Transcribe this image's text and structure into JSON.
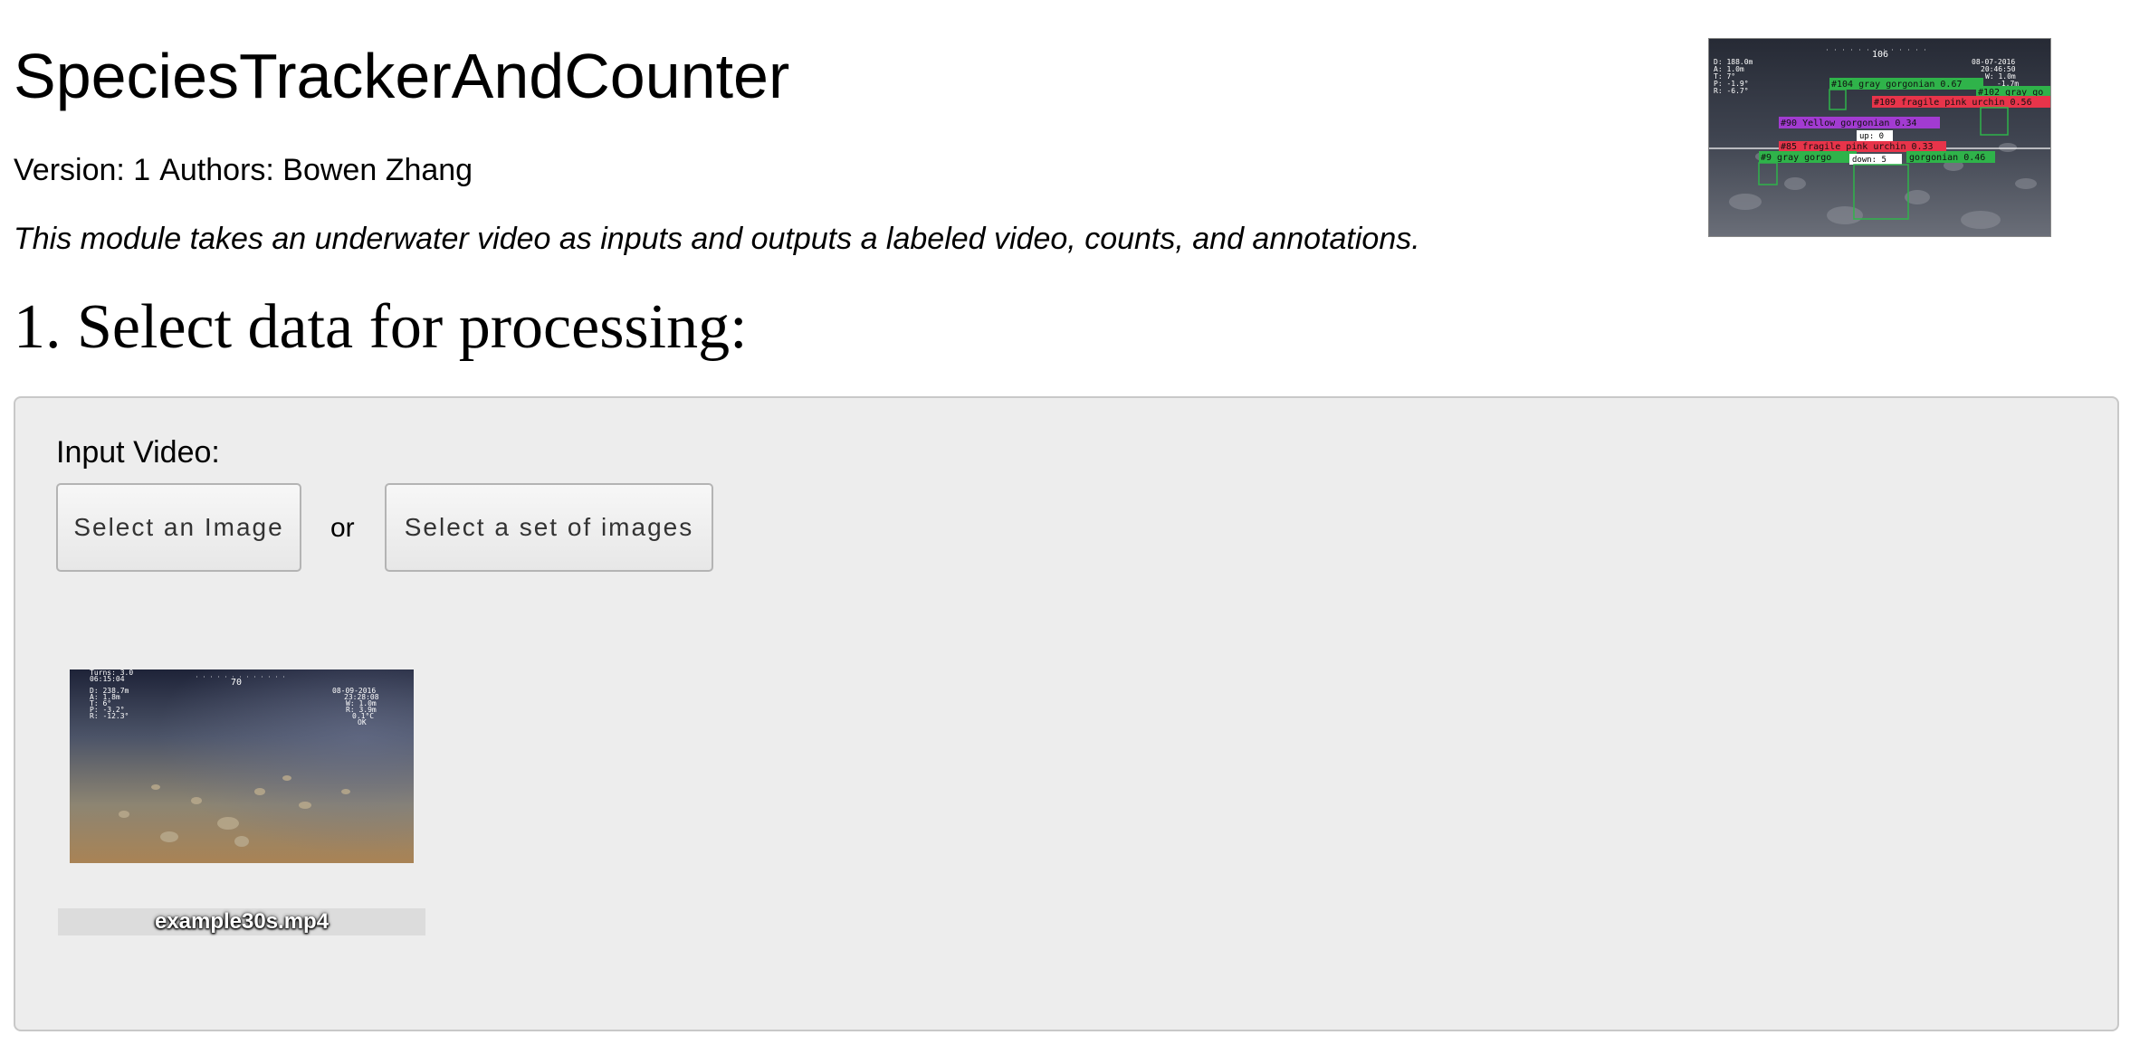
{
  "header": {
    "title": "SpeciesTrackerAndCounter",
    "version_text": "Version: 1",
    "authors_text": "Authors: Bowen Zhang",
    "description": "This module takes an underwater video as inputs and outputs a labeled video, counts, and annotations."
  },
  "hero_overlay": {
    "depth_readout": [
      "D: 188.0m",
      "A: 1.0m",
      "T: 7°",
      "P: -1.9°",
      "R: -6.7°"
    ],
    "heading": "106",
    "date": "08-07-2016",
    "time": "20:46:50",
    "right_readout": [
      "W: 1.0m",
      "-1.7m"
    ],
    "detections": [
      {
        "label": "#104 gray gorgonian 0.67",
        "color": "#2fb34a"
      },
      {
        "label": "#102 gray go",
        "color": "#2fb34a"
      },
      {
        "label": "#109 fragile pink urchin 0.56",
        "color": "#e8344a"
      },
      {
        "label": "#90 Yellow gorgonian 0.34",
        "color": "#a23bd1"
      },
      {
        "label": "#85 fragile pink urchin 0.33",
        "color": "#e8344a"
      },
      {
        "label": "#9 gray gorgo",
        "color": "#2fb34a"
      },
      {
        "label": "gorgonian 0.46",
        "color": "#2fb34a"
      }
    ],
    "count_up": "up: 0",
    "count_down": "down: 5"
  },
  "section": {
    "heading": "1. Select data for processing:"
  },
  "panel": {
    "input_label": "Input Video:",
    "select_single_label": "Select an Image",
    "or_text": "or",
    "select_set_label": "Select a set of images"
  },
  "file_item": {
    "name": "example30s.mp4",
    "thumb_overlay": {
      "top_left": [
        "Turns: 3.0",
        "06:15:04"
      ],
      "left_readout": [
        "D: 238.7m",
        "A: 1.8m",
        "T: 6°",
        "P: -3.2°",
        "R: -12.3°"
      ],
      "heading": "70",
      "date": "08-09-2016",
      "time": "23:28:08",
      "right_readout": [
        "W: 1.0m",
        "R: 3.9m",
        "0.1°C",
        "OK"
      ]
    }
  },
  "colors": {
    "panel_background": "#ededed",
    "detection_green": "#2fb34a",
    "detection_red": "#e8344a",
    "detection_purple": "#a23bd1"
  }
}
